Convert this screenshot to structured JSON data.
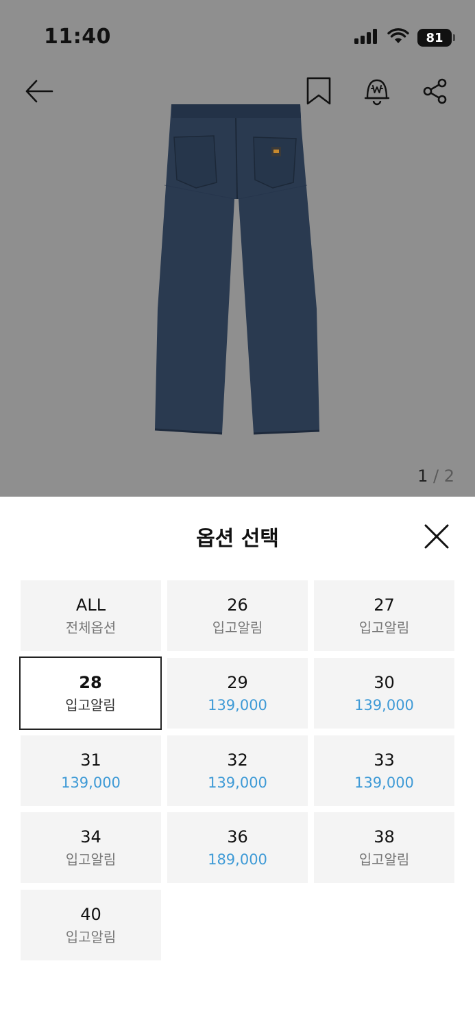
{
  "status_bar": {
    "time": "11:40",
    "battery": "81"
  },
  "product": {
    "page_current": "1",
    "page_separator": "/",
    "page_total": "2"
  },
  "sheet": {
    "title": "옵션 선택",
    "options": [
      {
        "size": "ALL",
        "sub": "전체옵션",
        "type": "label",
        "selected": false
      },
      {
        "size": "26",
        "sub": "입고알림",
        "type": "label",
        "selected": false
      },
      {
        "size": "27",
        "sub": "입고알림",
        "type": "label",
        "selected": false
      },
      {
        "size": "28",
        "sub": "입고알림",
        "type": "label",
        "selected": true
      },
      {
        "size": "29",
        "sub": "139,000",
        "type": "price",
        "selected": false
      },
      {
        "size": "30",
        "sub": "139,000",
        "type": "price",
        "selected": false
      },
      {
        "size": "31",
        "sub": "139,000",
        "type": "price",
        "selected": false
      },
      {
        "size": "32",
        "sub": "139,000",
        "type": "price",
        "selected": false
      },
      {
        "size": "33",
        "sub": "139,000",
        "type": "price",
        "selected": false
      },
      {
        "size": "34",
        "sub": "입고알림",
        "type": "label",
        "selected": false
      },
      {
        "size": "36",
        "sub": "189,000",
        "type": "price",
        "selected": false
      },
      {
        "size": "38",
        "sub": "입고알림",
        "type": "label",
        "selected": false
      },
      {
        "size": "40",
        "sub": "입고알림",
        "type": "label",
        "selected": false
      }
    ]
  },
  "icons": {
    "back": "arrow-left-icon",
    "bookmark": "bookmark-icon",
    "price_alert": "price-alert-bell-icon",
    "share": "share-icon",
    "close": "close-icon"
  },
  "colors": {
    "price": "#3e9ad6",
    "overlay": "#8f8f8f",
    "tile": "#f4f4f4"
  }
}
